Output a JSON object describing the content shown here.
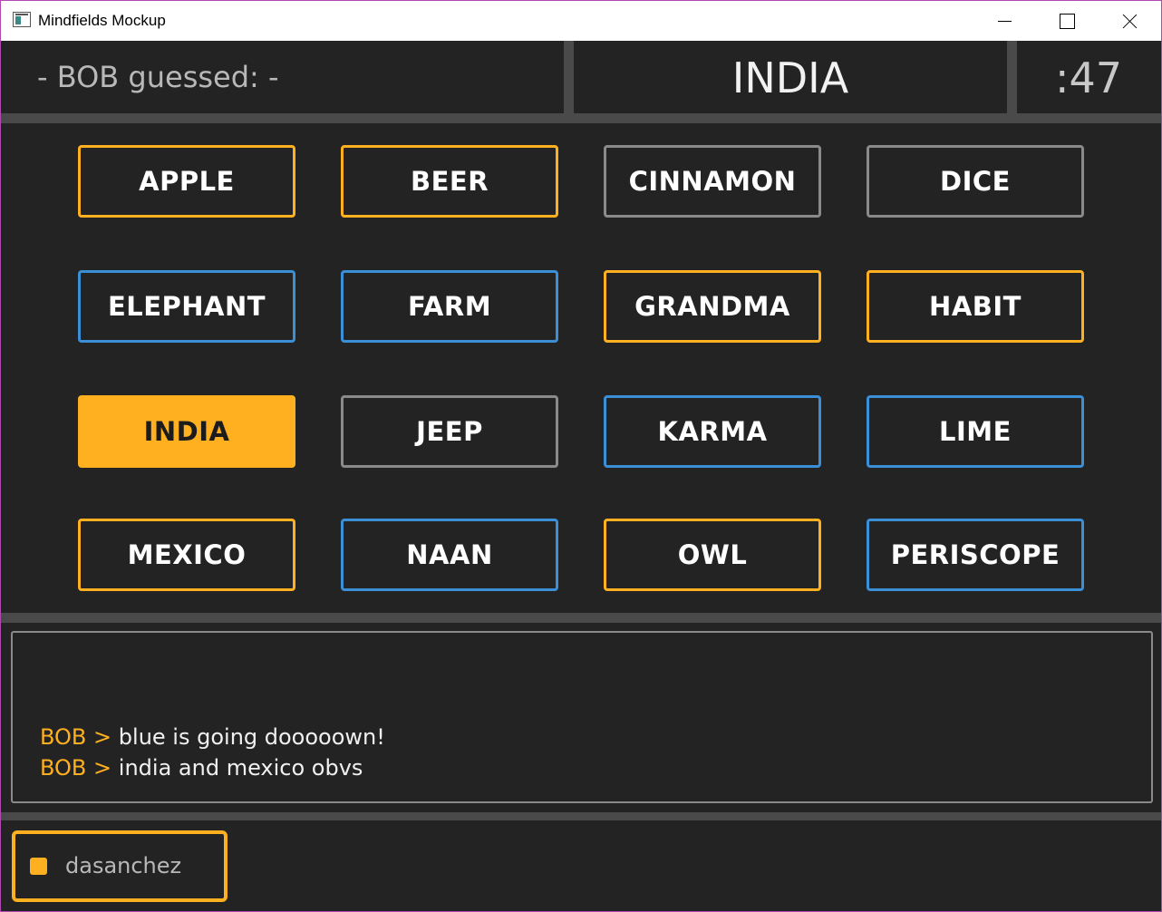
{
  "window": {
    "title": "Mindfields Mockup"
  },
  "header": {
    "guess_status": "- BOB guessed: -",
    "clue": "INDIA",
    "timer": ":47"
  },
  "colors": {
    "orange": "#ffb020",
    "blue": "#3a8fd6",
    "grey": "#8a8a8a",
    "background": "#232323",
    "separator": "#4a4a4a"
  },
  "board": {
    "cards": [
      {
        "word": "APPLE",
        "color": "orange",
        "selected": false
      },
      {
        "word": "BEER",
        "color": "orange",
        "selected": false
      },
      {
        "word": "CINNAMON",
        "color": "grey",
        "selected": false
      },
      {
        "word": "DICE",
        "color": "grey",
        "selected": false
      },
      {
        "word": "ELEPHANT",
        "color": "blue",
        "selected": false
      },
      {
        "word": "FARM",
        "color": "blue",
        "selected": false
      },
      {
        "word": "GRANDMA",
        "color": "orange",
        "selected": false
      },
      {
        "word": "HABIT",
        "color": "orange",
        "selected": false
      },
      {
        "word": "INDIA",
        "color": "orange",
        "selected": true
      },
      {
        "word": "JEEP",
        "color": "grey",
        "selected": false
      },
      {
        "word": "KARMA",
        "color": "blue",
        "selected": false
      },
      {
        "word": "LIME",
        "color": "blue",
        "selected": false
      },
      {
        "word": "MEXICO",
        "color": "orange",
        "selected": false
      },
      {
        "word": "NAAN",
        "color": "blue",
        "selected": false
      },
      {
        "word": "OWL",
        "color": "orange",
        "selected": false
      },
      {
        "word": "PERISCOPE",
        "color": "blue",
        "selected": false
      }
    ]
  },
  "chat": {
    "messages": [
      {
        "name": "BOB",
        "separator": ">",
        "text": "blue is going dooooown!"
      },
      {
        "name": "BOB",
        "separator": ">",
        "text": "india and mexico obvs"
      }
    ]
  },
  "player": {
    "name": "dasanchez",
    "color": "orange"
  }
}
